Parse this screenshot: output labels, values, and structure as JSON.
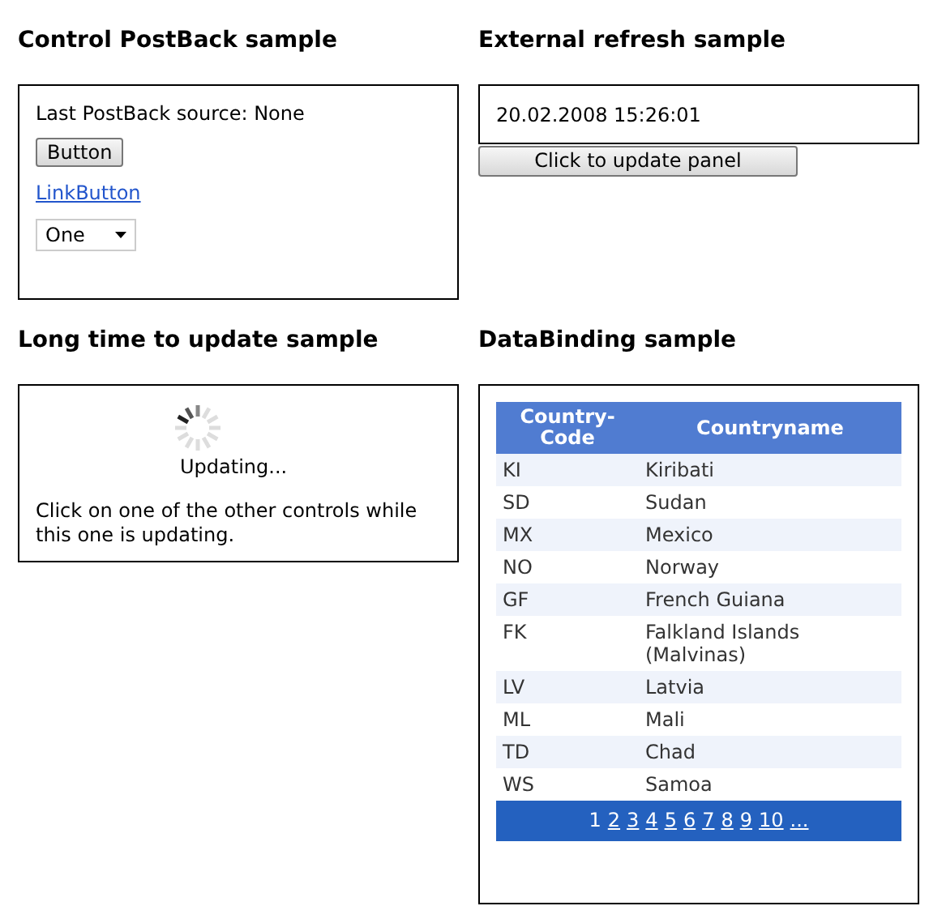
{
  "postback": {
    "title": "Control PostBack sample",
    "source_label": "Last PostBack source: None",
    "button": "Button",
    "link": "LinkButton",
    "dropdown": {
      "value": "One"
    }
  },
  "external": {
    "title": "External refresh sample",
    "timestamp": "20.02.2008 15:26:01",
    "button": "Click to update panel"
  },
  "longtime": {
    "title": "Long time to update sample",
    "status": "Updating...",
    "note": "Click on one of the other controls while this one is updating."
  },
  "databinding": {
    "title": "DataBinding sample",
    "columns": [
      "Country-Code",
      "Countryname"
    ],
    "rows": [
      {
        "code": "KI",
        "name": "Kiribati"
      },
      {
        "code": "SD",
        "name": "Sudan"
      },
      {
        "code": "MX",
        "name": "Mexico"
      },
      {
        "code": "NO",
        "name": "Norway"
      },
      {
        "code": "GF",
        "name": "French Guiana"
      },
      {
        "code": "FK",
        "name": "Falkland Islands (Malvinas)"
      },
      {
        "code": "LV",
        "name": "Latvia"
      },
      {
        "code": "ML",
        "name": "Mali"
      },
      {
        "code": "TD",
        "name": "Chad"
      },
      {
        "code": "WS",
        "name": "Samoa"
      }
    ],
    "pages": [
      {
        "label": "1",
        "selected": true
      },
      {
        "label": "2",
        "selected": false
      },
      {
        "label": "3",
        "selected": false
      },
      {
        "label": "4",
        "selected": false
      },
      {
        "label": "5",
        "selected": false
      },
      {
        "label": "6",
        "selected": false
      },
      {
        "label": "7",
        "selected": false
      },
      {
        "label": "8",
        "selected": false
      },
      {
        "label": "9",
        "selected": false
      },
      {
        "label": "10",
        "selected": false
      },
      {
        "label": "...",
        "selected": false
      }
    ]
  }
}
